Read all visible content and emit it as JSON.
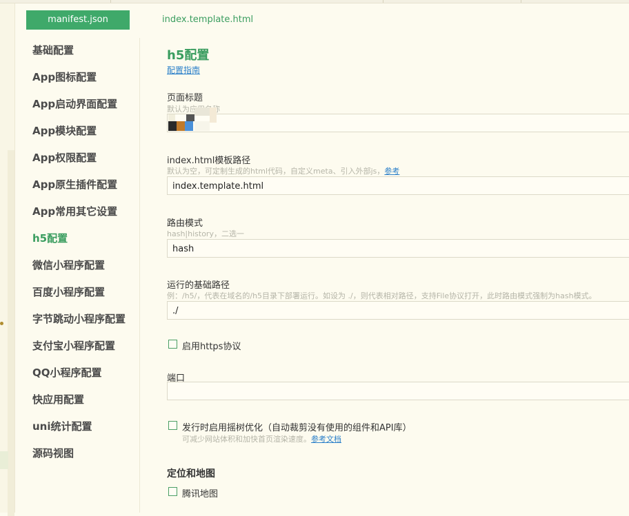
{
  "tabs": [
    {
      "label": "manifest.json",
      "active": true
    },
    {
      "label": "index.template.html",
      "active": false
    }
  ],
  "sidebar": {
    "items": [
      {
        "label": "基础配置"
      },
      {
        "label": "App图标配置"
      },
      {
        "label": "App启动界面配置"
      },
      {
        "label": "App模块配置"
      },
      {
        "label": "App权限配置"
      },
      {
        "label": "App原生插件配置"
      },
      {
        "label": "App常用其它设置"
      },
      {
        "label": "h5配置",
        "active": true
      },
      {
        "label": "微信小程序配置"
      },
      {
        "label": "百度小程序配置"
      },
      {
        "label": "字节跳动小程序配置"
      },
      {
        "label": "支付宝小程序配置"
      },
      {
        "label": "QQ小程序配置"
      },
      {
        "label": "快应用配置"
      },
      {
        "label": "uni统计配置"
      },
      {
        "label": "源码视图"
      }
    ]
  },
  "main": {
    "title": "h5配置",
    "guide_link": "配置指南",
    "page_title": {
      "label": "页面标题",
      "hint": "默认为应用名称",
      "value": ""
    },
    "template_path": {
      "label": "index.html模板路径",
      "hint": "默认为空，可定制生成的html代码，自定义meta、引入外部js，",
      "hint_link": "参考",
      "value": "index.template.html"
    },
    "router_mode": {
      "label": "路由模式",
      "hint": "hash|history，二选一",
      "value": "hash"
    },
    "base_path": {
      "label": "运行的基础路径",
      "hint": "例：/h5/，代表在域名的/h5目录下部署运行。如设为 ./，则代表相对路径，支持File协议打开，此时路由模式强制为hash模式。",
      "value": "./"
    },
    "https": {
      "label": "启用https协议",
      "checked": false
    },
    "port": {
      "label": "端口",
      "value": ""
    },
    "treeshake": {
      "label": "发行时启用摇树优化（自动裁剪没有使用的组件和API库）",
      "hint": "可减少网站体积和加快首页渲染速度。",
      "hint_link": "参考文档",
      "checked": false
    },
    "location_section": "定位和地图",
    "tencent_map": {
      "label": "腾讯地图",
      "checked": false
    }
  },
  "colors": {
    "accent": "#3fa96a",
    "link": "#2a7fc9",
    "background": "#fdfbef"
  }
}
